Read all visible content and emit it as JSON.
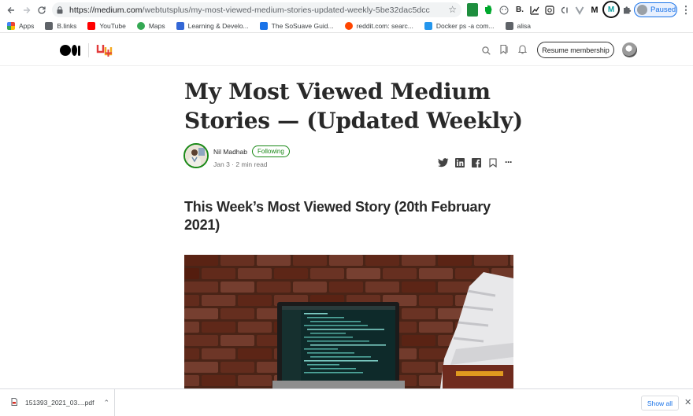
{
  "browser": {
    "url_host": "https://medium.com",
    "url_path": "/webtutsplus/my-most-viewed-medium-stories-updated-weekly-5be32dac5dcc",
    "profile_label": "Paused",
    "extensions": [
      "B.",
      "M",
      "M"
    ]
  },
  "bookmarks": [
    {
      "label": "Apps",
      "icon": "apps-grid-icon",
      "color": "#ea4335"
    },
    {
      "label": "B.links",
      "icon": "folder-icon",
      "color": "#5f6368"
    },
    {
      "label": "YouTube",
      "icon": "youtube-icon",
      "color": "#ff0000"
    },
    {
      "label": "Maps",
      "icon": "maps-icon",
      "color": "#34a853"
    },
    {
      "label": "Learning & Develo...",
      "icon": "calendar-icon",
      "color": "#3367d6"
    },
    {
      "label": "The SoSuave Guid...",
      "icon": "ss-icon",
      "color": "#1a73e8"
    },
    {
      "label": "reddit.com: searc...",
      "icon": "reddit-icon",
      "color": "#ff4500"
    },
    {
      "label": "Docker ps -a com...",
      "icon": "docker-icon",
      "color": "#2496ed"
    },
    {
      "label": "alisa",
      "icon": "folder-icon",
      "color": "#5f6368"
    }
  ],
  "header": {
    "resume_label": "Resume membership"
  },
  "article": {
    "title": "My Most Viewed Medium Stories — (Updated Weekly)",
    "author": "Nil Madhab",
    "follow_label": "Following",
    "date": "Jan 3",
    "read_time": "2 min read",
    "section_heading": "This Week’s Most Viewed Story (20th February 2021)"
  },
  "downloads": {
    "filename": "151393_2021_03....pdf",
    "show_all_label": "Show all"
  },
  "colors": {
    "accent_green": "#1a8917",
    "chrome_blue": "#1a73e8",
    "text": "#292929"
  }
}
